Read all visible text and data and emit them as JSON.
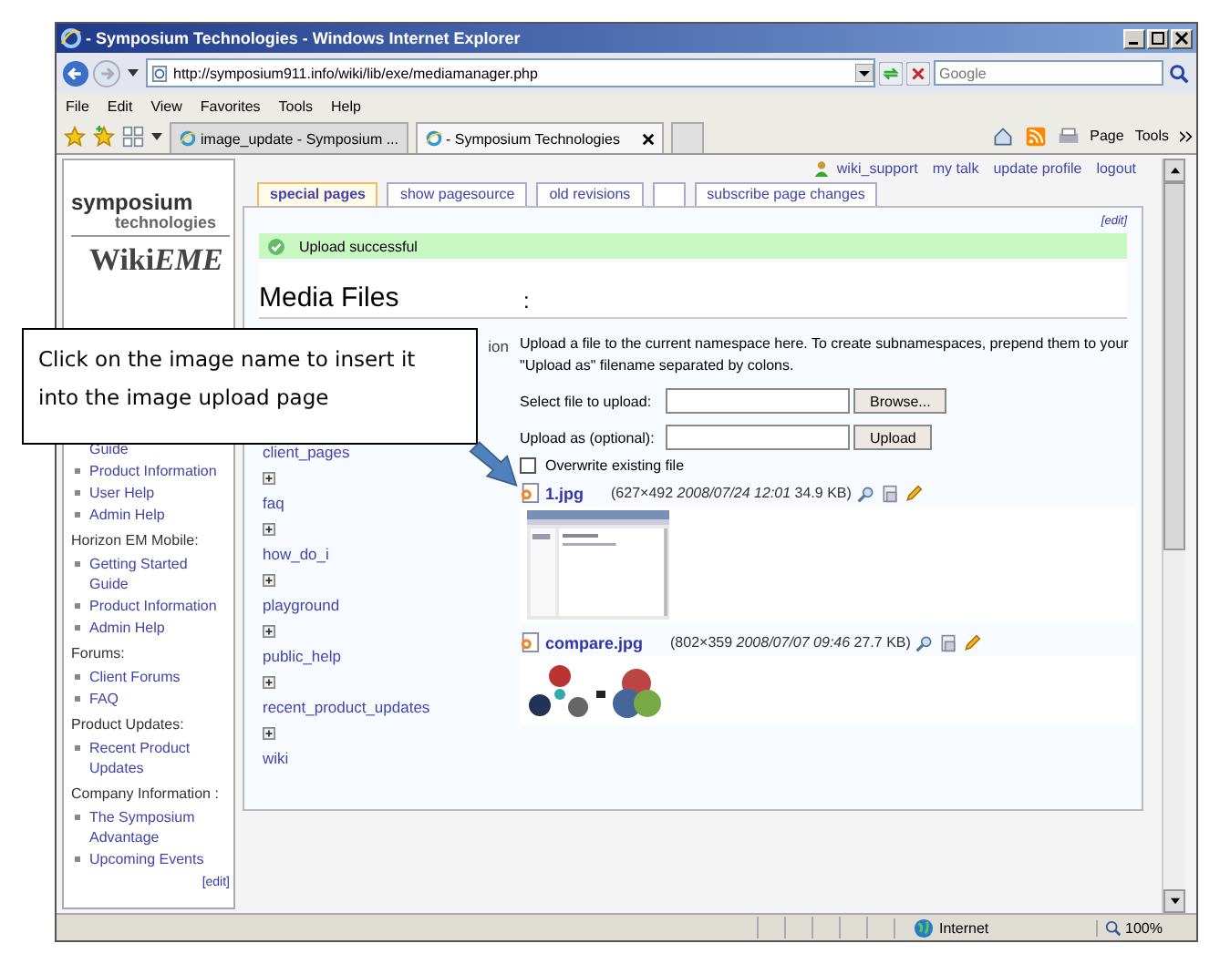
{
  "window": {
    "title": "- Symposium Technologies - Windows Internet Explorer"
  },
  "address_bar": {
    "url": "http://symposium911.info/wiki/lib/exe/mediamanager.php"
  },
  "search": {
    "placeholder": "Google"
  },
  "menu": [
    "File",
    "Edit",
    "View",
    "Favorites",
    "Tools",
    "Help"
  ],
  "browser_tabs": [
    {
      "label": "image_update - Symposium ...",
      "selected": false
    },
    {
      "label": "- Symposium Technologies",
      "selected": true
    }
  ],
  "command_bar": [
    "Page",
    "Tools"
  ],
  "user_links": [
    "wiki_support",
    "my talk",
    "update profile",
    "logout"
  ],
  "page_tabs": [
    {
      "kind": "label",
      "label": "special pages",
      "selected": true
    },
    {
      "kind": "label",
      "label": "show pagesource",
      "selected": false
    },
    {
      "kind": "label",
      "label": "old revisions",
      "selected": false
    },
    {
      "kind": "empty",
      "selected": false
    },
    {
      "kind": "label",
      "label": "subscribe page changes",
      "selected": false
    }
  ],
  "sidebar": {
    "logo": {
      "line_1": "symposium",
      "line_2": "technologies",
      "wordmark": "Wiki",
      "wordmark_italic": "EME"
    },
    "sections": [
      {
        "continued": true,
        "items": [
          "Guide",
          "Product Information",
          "User Help",
          "Admin Help"
        ]
      },
      {
        "heading": "Horizon EM Mobile:",
        "items": [
          "Getting Started Guide",
          "Product Information",
          "Admin Help"
        ]
      },
      {
        "heading": "Forums:",
        "items": [
          "Client Forums",
          "FAQ"
        ]
      },
      {
        "heading": "Product Updates:",
        "items": [
          "Recent Product Updates"
        ]
      },
      {
        "heading": "Company Information :",
        "items": [
          "The Symposium Advantage",
          "Upcoming Events"
        ]
      }
    ],
    "edit": "[edit]"
  },
  "main": {
    "edit": "[edit]",
    "notice": "Upload successful",
    "heading": "Media Files",
    "namespace": ":",
    "tree": {
      "partial_label": "ion",
      "namespaces": [
        {
          "name": "client_pages",
          "expander": false
        },
        {
          "name": "faq",
          "expander": true
        },
        {
          "name": "how_do_i",
          "expander": true
        },
        {
          "name": "playground",
          "expander": true
        },
        {
          "name": "public_help",
          "expander": true
        },
        {
          "name": "recent_product_updates",
          "expander": true
        },
        {
          "name": "wiki",
          "expander": true
        }
      ]
    },
    "upload": {
      "intro": "Upload a file to the current namespace here. To create subnamespaces, prepend them to your \"Upload as\" filename separated by colons.",
      "file_label": "Select file to upload:",
      "browse": "Browse...",
      "name_label": "Upload as (optional):",
      "upload": "Upload",
      "overwrite": {
        "label": "Overwrite existing file",
        "checked": false
      }
    },
    "files": [
      {
        "name": "1.jpg",
        "info": "(627×492 *2008/07/24 12:01* 34.9 KB)"
      },
      {
        "name": "compare.jpg",
        "info": "(802×359 *2008/07/07 09:46* 27.7 KB)"
      }
    ]
  },
  "callout": {
    "text": "Click on the image name to insert it into the image upload page"
  },
  "status_bar": {
    "zone": "Internet",
    "zoom": "100%"
  }
}
